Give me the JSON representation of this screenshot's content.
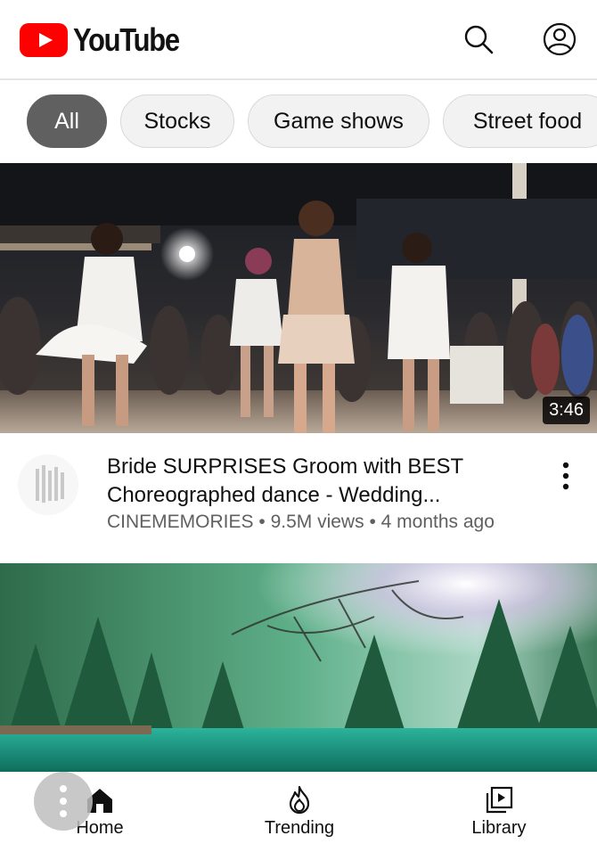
{
  "app": {
    "logo_text": "YouTube"
  },
  "header": {
    "search_icon": "search-icon",
    "account_icon": "account-icon"
  },
  "chips": [
    {
      "label": "All",
      "active": true
    },
    {
      "label": "Stocks",
      "active": false
    },
    {
      "label": "Game shows",
      "active": false
    },
    {
      "label": "Street food",
      "active": false
    }
  ],
  "videos": [
    {
      "duration": "3:46",
      "title": "Bride SURPRISES Groom with BEST Choreographed dance - Wedding...",
      "channel": "CINEMEMORIES",
      "views": "9.5M views",
      "age": "4 months ago",
      "separator": "•"
    },
    {}
  ],
  "bottom_nav": {
    "home": "Home",
    "trending": "Trending",
    "library": "Library"
  },
  "colors": {
    "brand_red": "#ff0000",
    "chip_active": "#606060",
    "meta_text": "#606060"
  }
}
